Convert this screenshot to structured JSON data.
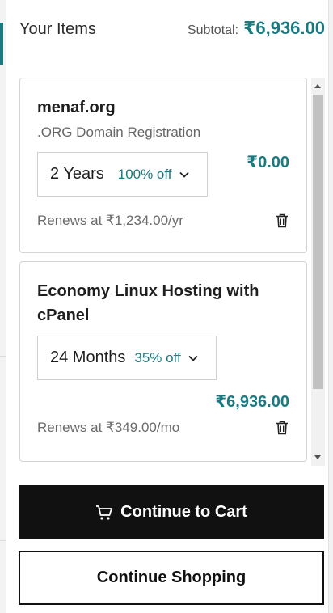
{
  "header": {
    "title": "Your Items",
    "subtotal_label": "Subtotal:",
    "subtotal_value": "₹6,936.00"
  },
  "items": [
    {
      "name": "menaf.org",
      "description": ".ORG Domain Registration",
      "term": "2 Years",
      "discount": "100% off",
      "price": "₹0.00",
      "renewal": "Renews at ₹1,234.00/yr"
    },
    {
      "name": "Economy Linux Hosting with cPanel",
      "term": "24 Months",
      "discount": "35% off",
      "price": "₹6,936.00",
      "renewal": "Renews at ₹349.00/mo"
    }
  ],
  "buttons": {
    "continue_to_cart": "Continue to Cart",
    "continue_shopping": "Continue Shopping"
  },
  "icons": {
    "cart": "shopping-cart-icon",
    "delete": "trash-icon",
    "dropdown": "chevron-down-icon"
  },
  "colors": {
    "accent": "#1b7a80",
    "primary_button": "#111111"
  }
}
